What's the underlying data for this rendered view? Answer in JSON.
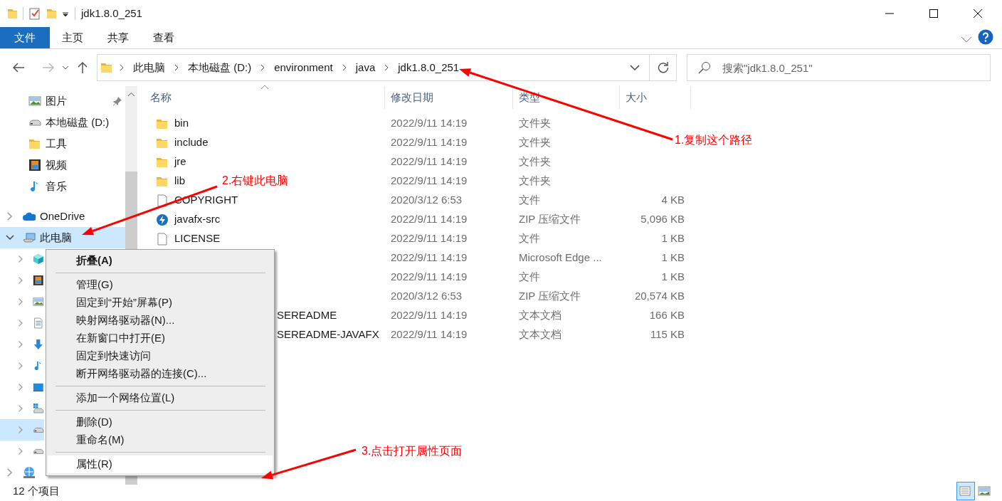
{
  "window": {
    "title": "jdk1.8.0_251"
  },
  "ribbon": {
    "tabs": [
      {
        "label": "文件",
        "selected": true
      },
      {
        "label": "主页",
        "selected": false
      },
      {
        "label": "共享",
        "selected": false
      },
      {
        "label": "查看",
        "selected": false
      }
    ]
  },
  "address_bar": {
    "path": [
      "此电脑",
      "本地磁盘 (D:)",
      "environment",
      "java",
      "jdk1.8.0_251"
    ]
  },
  "search": {
    "placeholder": "搜索\"jdk1.8.0_251\""
  },
  "navigation": {
    "quick_access": [
      {
        "label": "图片",
        "kind": "pictures",
        "pinned": true
      },
      {
        "label": "本地磁盘 (D:)",
        "kind": "drive",
        "pinned": false
      },
      {
        "label": "工具",
        "kind": "folder",
        "pinned": false
      },
      {
        "label": "视频",
        "kind": "videos",
        "pinned": false
      },
      {
        "label": "音乐",
        "kind": "music",
        "pinned": false
      }
    ],
    "items": [
      {
        "label": "OneDrive",
        "kind": "cloud",
        "expanded": false,
        "selected": false
      },
      {
        "label": "此电脑",
        "kind": "pc",
        "expanded": true,
        "selected": true,
        "children": [
          {
            "kind": "cube",
            "expanded": false,
            "selected": false
          },
          {
            "kind": "videos",
            "expanded": false,
            "selected": false
          },
          {
            "kind": "pictures",
            "expanded": false,
            "selected": false
          },
          {
            "kind": "documents",
            "expanded": false,
            "selected": false
          },
          {
            "kind": "downloads",
            "expanded": false,
            "selected": false
          },
          {
            "kind": "music",
            "expanded": false,
            "selected": false
          },
          {
            "kind": "desktop",
            "expanded": false,
            "selected": false
          },
          {
            "kind": "windows-drive",
            "expanded": false,
            "selected": false
          },
          {
            "kind": "drive",
            "expanded": false,
            "selected": true
          },
          {
            "kind": "drive",
            "expanded": false,
            "selected": false
          }
        ]
      },
      {
        "kind": "network",
        "expanded": false,
        "selected": false
      }
    ]
  },
  "file_list": {
    "columns": [
      {
        "label": "名称",
        "sorted": true
      },
      {
        "label": "修改日期",
        "sorted": false
      },
      {
        "label": "类型",
        "sorted": false
      },
      {
        "label": "大小",
        "sorted": false
      }
    ],
    "rows": [
      {
        "kind": "folder",
        "name": "bin",
        "modified": "2022/9/11 14:19",
        "type": "文件夹"
      },
      {
        "kind": "folder",
        "name": "include",
        "modified": "2022/9/11 14:19",
        "type": "文件夹"
      },
      {
        "kind": "folder",
        "name": "jre",
        "modified": "2022/9/11 14:19",
        "type": "文件夹"
      },
      {
        "kind": "folder",
        "name": "lib",
        "modified": "2022/9/11 14:19",
        "type": "文件夹"
      },
      {
        "kind": "file",
        "name": "COPYRIGHT",
        "modified": "2020/3/12 6:53",
        "type": "文件",
        "size": "4 KB"
      },
      {
        "kind": "zip",
        "name": "javafx-src",
        "modified": "2022/9/11 14:19",
        "type": "ZIP 压缩文件",
        "size": "5,096 KB"
      },
      {
        "kind": "file",
        "name": "LICENSE",
        "modified": "2022/9/11 14:19",
        "type": "文件",
        "size": "1 KB"
      },
      {
        "kind": "covered",
        "modified": "2022/9/11 14:19",
        "type": "Microsoft Edge ...",
        "size": "1 KB"
      },
      {
        "kind": "covered",
        "modified": "2022/9/11 14:19",
        "type": "文件",
        "size": "1 KB"
      },
      {
        "kind": "covered",
        "modified": "2020/3/12 6:53",
        "type": "ZIP 压缩文件",
        "size": "20,574 KB"
      },
      {
        "kind": "covered",
        "name": "SEREADME",
        "modified": "2022/9/11 14:19",
        "type": "文本文档",
        "size": "166 KB"
      },
      {
        "kind": "covered",
        "name": "SEREADME-JAVAFX",
        "modified": "2022/9/11 14:19",
        "type": "文本文档",
        "size": "115 KB"
      }
    ]
  },
  "context_menu": {
    "items": [
      {
        "kind": "item",
        "label": "折叠(A)",
        "default": true,
        "selected": false
      },
      {
        "kind": "separator"
      },
      {
        "kind": "item",
        "label": "管理(G)",
        "default": false,
        "selected": false
      },
      {
        "kind": "item",
        "label": "固定到“开始”屏幕(P)",
        "default": false,
        "selected": false
      },
      {
        "kind": "item",
        "label": "映射网络驱动器(N)...",
        "default": false,
        "selected": false
      },
      {
        "kind": "item",
        "label": "在新窗口中打开(E)",
        "default": false,
        "selected": false
      },
      {
        "kind": "item",
        "label": "固定到快速访问",
        "default": false,
        "selected": false
      },
      {
        "kind": "item",
        "label": "断开网络驱动器的连接(C)...",
        "default": false,
        "selected": false
      },
      {
        "kind": "separator"
      },
      {
        "kind": "item",
        "label": "添加一个网络位置(L)",
        "default": false,
        "selected": false
      },
      {
        "kind": "separator"
      },
      {
        "kind": "item",
        "label": "删除(D)",
        "default": false,
        "selected": false
      },
      {
        "kind": "item",
        "label": "重命名(M)",
        "default": false,
        "selected": false
      },
      {
        "kind": "separator"
      },
      {
        "kind": "item",
        "label": "属性(R)",
        "default": false,
        "selected": true
      }
    ]
  },
  "annotations": [
    {
      "text": "1.复制这个路径"
    },
    {
      "text": "2.右键此电脑"
    },
    {
      "text": "3.点击打开属性页面"
    }
  ],
  "status_bar": {
    "item_count": "12 个项目",
    "views": [
      {
        "kind": "details",
        "selected": true
      },
      {
        "kind": "large-icons",
        "selected": false
      }
    ]
  }
}
